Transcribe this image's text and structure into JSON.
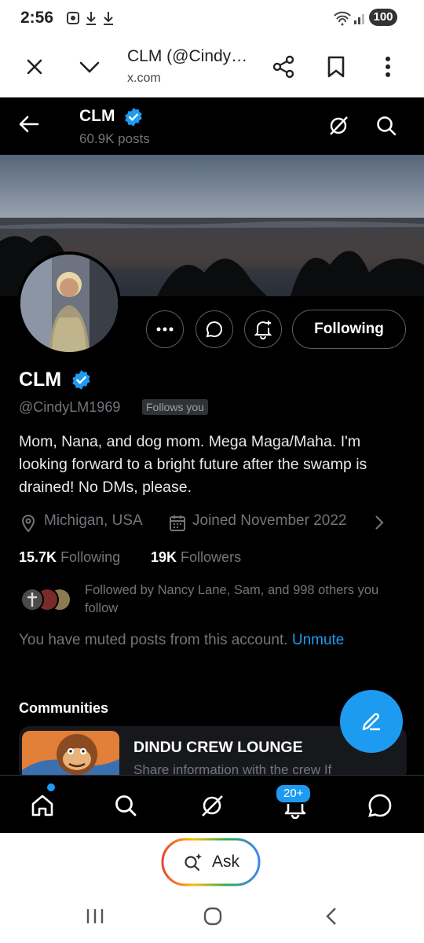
{
  "status_bar": {
    "time": "2:56",
    "battery": "100"
  },
  "browser": {
    "title": "CLM (@Cindy…",
    "url": "x.com"
  },
  "header": {
    "name": "CLM",
    "posts": "60.9K posts"
  },
  "profile": {
    "name": "CLM",
    "handle": "@CindyLM1969",
    "follows_you": "Follows you",
    "follow_button": "Following",
    "bio": "Mom, Nana, and dog mom. Mega Maga/Maha. I'm looking forward to a bright future after the swamp is drained! No DMs, please.",
    "location": "Michigan, USA",
    "joined": "Joined November 2022",
    "following_count": "15.7K",
    "following_label": "Following",
    "followers_count": "19K",
    "followers_label": "Followers",
    "followed_by": "Followed by Nancy Lane, Sam, and 998 others you follow",
    "muted_text": "You have muted posts from this account.",
    "unmute": "Unmute"
  },
  "communities": {
    "title": "Communities",
    "items": [
      {
        "name": "DINDU CREW LOUNGE",
        "description": "Share information with the crew If"
      }
    ]
  },
  "tabbar": {
    "notifications_badge": "20+"
  },
  "assistant": {
    "label": "Ask"
  },
  "colors": {
    "accent": "#1d9bf0",
    "background": "#000000",
    "secondary_text": "#71767b"
  }
}
